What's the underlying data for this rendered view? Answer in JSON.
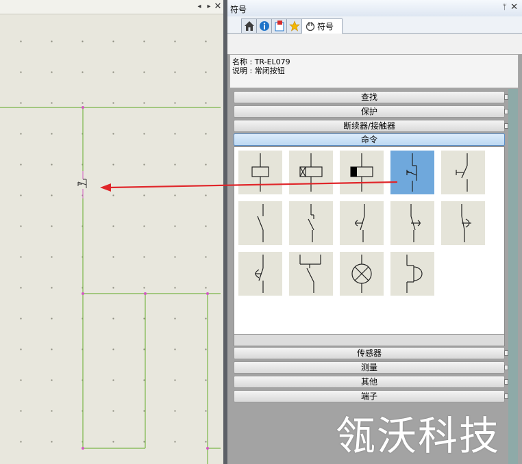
{
  "canvas": {
    "nav_prev": "◂",
    "nav_next": "▸",
    "close": "✕"
  },
  "panel": {
    "title": "符号",
    "pin": "ᛘ",
    "close": "✕",
    "tabs": [
      {
        "icon": "home-icon"
      },
      {
        "icon": "info-icon"
      },
      {
        "icon": "library-icon"
      },
      {
        "icon": "star-icon"
      },
      {
        "icon": "symbol-icon",
        "label": "符号"
      }
    ],
    "info": {
      "name_line": "名称 : TR-EL079",
      "desc_line": "说明 : 常闭按钮"
    },
    "categories_top": [
      "查找",
      "保护",
      "断续器/接触器"
    ],
    "active_category": "命令",
    "categories_bottom": [
      "传感器",
      "测量",
      "其他",
      "端子"
    ],
    "selected_symbol": 3,
    "symbols": [
      {
        "icon": "coil-icon"
      },
      {
        "icon": "coil-crossed-icon"
      },
      {
        "icon": "coil-filled-icon"
      },
      {
        "icon": "nc-pushbutton-icon"
      },
      {
        "icon": "no-pushbutton-icon"
      },
      {
        "icon": "switch-contact-icon"
      },
      {
        "icon": "switch-latched-icon"
      },
      {
        "icon": "switch-turn-icon"
      },
      {
        "icon": "switch-turn-right-icon"
      },
      {
        "icon": "switch-rotary-icon"
      },
      {
        "icon": "switch-pull-icon"
      },
      {
        "icon": "switch-bracket-icon"
      },
      {
        "icon": "lamp-icon"
      },
      {
        "icon": "mushroom-button-icon"
      }
    ]
  },
  "watermark": "瓴沃科技",
  "colors": {
    "wire": "#7ab648",
    "node": "#d25bc1",
    "arrow": "#e0262a",
    "selection": "#6fa8dc"
  }
}
